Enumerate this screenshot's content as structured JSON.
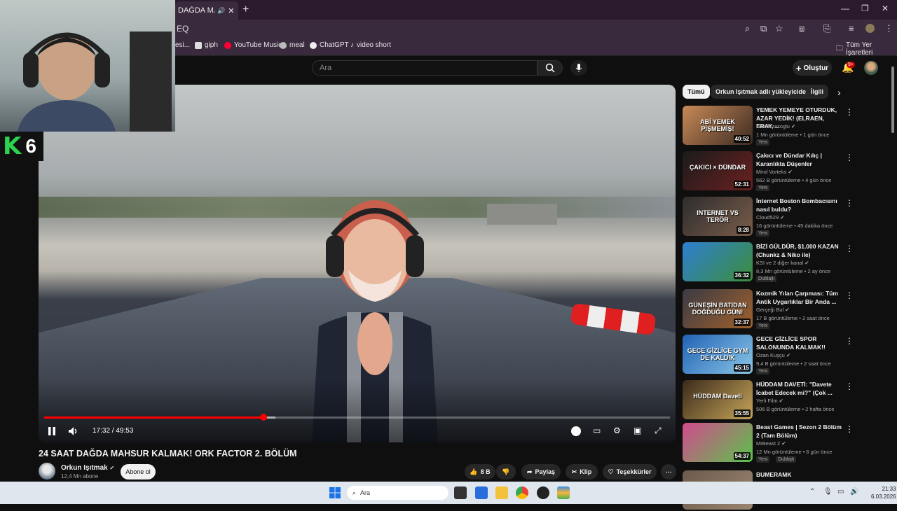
{
  "browser": {
    "tab_title": "DAĞDA MAHS",
    "url_fragment": "EQ",
    "bookmarks": [
      "esi...",
      "giph",
      "YouTube Music",
      "meal",
      "ChatGPT",
      "video short"
    ],
    "all_bookmarks": "Tüm Yer İşaretleri"
  },
  "header": {
    "search_placeholder": "Ara",
    "create_label": "Oluştur",
    "notif_count": "9+"
  },
  "player": {
    "time": "17:32 / 49:53",
    "progress_fraction": 0.351,
    "buffer_fraction": 0.37,
    "pip_badge": "6"
  },
  "video": {
    "title": "24 SAAT DAĞDA MAHSUR KALMAK! ORK FACTOR 2. BÖLÜM",
    "channel": "Orkun Işıtmak",
    "subscribers": "12,4 Mn abone",
    "subscribe_label": "Abone ol",
    "likes": "8 B",
    "share_label": "Paylaş",
    "clip_label": "Klip",
    "thanks_label": "Teşekkürler"
  },
  "sidebar": {
    "chips": [
      "Tümü",
      "Orkun Işıtmak adlı yükleyiciden",
      "İlgili"
    ],
    "recommendations": [
      {
        "title": "YEMEK YEMEYE OTURDUK, AZAR YEDİK! (ELRAEN, ERAY, ...",
        "channel": "Enis Kirazoglu",
        "meta": "1 Mn görüntüleme • 1 gün önce",
        "badge": "Yeni",
        "duration": "40:52",
        "thumb_text": "ABİ YEMEK PİŞMEMİŞ!",
        "colors": [
          "#c98a57",
          "#3b2a21"
        ]
      },
      {
        "title": "Çakıcı ve Dündar Kılıç | Karanlıkta Düşenler",
        "channel": "Mind Vorteks",
        "meta": "562 B görüntüleme • 4 gün önce",
        "badge": "Yeni",
        "duration": "52:31",
        "thumb_text": "ÇAKICI × DÜNDAR",
        "colors": [
          "#1b1b1b",
          "#6b2020"
        ]
      },
      {
        "title": "İnternet Boston Bombacısını nasıl buldu?",
        "channel": "Cloud529",
        "meta": "16 görüntüleme • 45 dakika önce",
        "badge": "Yeni",
        "duration": "8:28",
        "thumb_text": "INTERNET VS TERÖR",
        "colors": [
          "#2d2d2d",
          "#7a5c4a"
        ]
      },
      {
        "title": "BİZİ GÜLDÜR, $1.000 KAZAN (Chunkz & Niko ile)",
        "channel": "KSI ve 2 diğer kanal",
        "meta": "8,3 Mn görüntüleme • 2 ay önce",
        "badge": "Dublajlı",
        "duration": "36:32",
        "thumb_text": "",
        "colors": [
          "#2e7fd1",
          "#3d8d3a"
        ]
      },
      {
        "title": "Kozmik Yılan Çarpması: Tüm Antik Uygarlıklar Bir Anda ...",
        "channel": "Gerçeği Bul",
        "meta": "17 B görüntüleme • 2 saat önce",
        "badge": "Yeni",
        "duration": "32:37",
        "thumb_text": "GÜNEŞİN BATIDAN DOĞDUĞU GÜN!",
        "colors": [
          "#3a3a44",
          "#a0612c"
        ]
      },
      {
        "title": "GECE GİZLİCE SPOR SALONUNDA KALMAK!!",
        "channel": "Ozan Kuşçu",
        "meta": "9,4 B görüntüleme • 2 saat önce",
        "badge": "Yeni",
        "duration": "45:15",
        "thumb_text": "GECE GİZLİCE GYM DE KALDIK",
        "colors": [
          "#2163b5",
          "#8ac5e6"
        ]
      },
      {
        "title": "HÜDDAM DAVETİ: \"Davete İcabet Edecek mi?\" (Çok ...",
        "channel": "Yerli Film",
        "meta": "506 B görüntüleme • 2 hafta önce",
        "badge": "",
        "duration": "35:55",
        "thumb_text": "HÜDDAM Daveti",
        "colors": [
          "#3a2a1a",
          "#c7a55a"
        ]
      },
      {
        "title": "Beast Games | Sezon 2 Bölüm 2 (Tam Bölüm)",
        "channel": "MrBeast 2",
        "meta": "12 Mn görüntüleme • 6 gün önce",
        "badge": "Yeni",
        "badge2": "Dublajlı",
        "duration": "54:37",
        "thumb_text": "",
        "colors": [
          "#d24a8e",
          "#5ac24a"
        ]
      },
      {
        "title": "BUMERAMK",
        "channel": "",
        "meta": "",
        "badge": "",
        "duration": "",
        "thumb_text": "",
        "colors": [
          "#6d5a4a",
          "#9b8573"
        ]
      }
    ]
  },
  "taskbar": {
    "search_label": "Ara",
    "time": "21:33",
    "date": "6.03.2026"
  }
}
